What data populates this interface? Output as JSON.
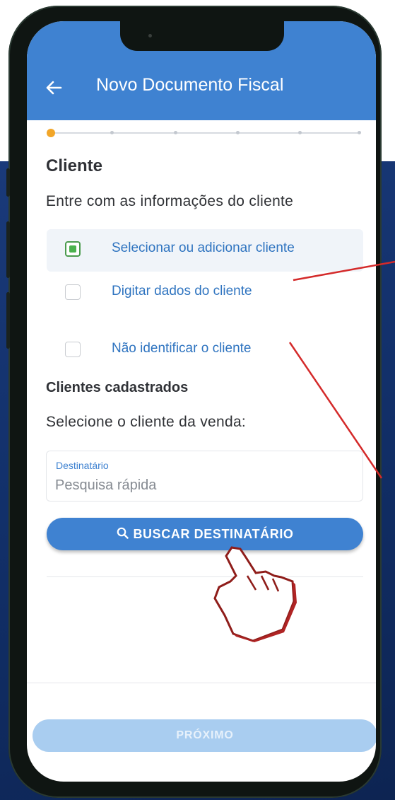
{
  "colors": {
    "appbar": "#3f82d1",
    "link": "#2f74c0",
    "check": "#4bb24e",
    "stepper_active": "#f2a629",
    "annotation": "#d42a2a",
    "next_disabled": "#a9cdf0"
  },
  "appbar": {
    "back_icon": "arrow-left-icon",
    "title": "Novo Documento Fiscal"
  },
  "stepper": {
    "total_steps": 6,
    "current_step": 1
  },
  "section": {
    "title": "Cliente",
    "subtitle": "Entre com as informações do cliente"
  },
  "options": [
    {
      "label": "Selecionar ou adicionar cliente",
      "checked": true
    },
    {
      "label": "Digitar dados do cliente",
      "checked": false
    },
    {
      "label": "Não identificar o cliente",
      "checked": false
    }
  ],
  "registered": {
    "title": "Clientes cadastrados",
    "prompt": "Selecione o cliente da venda:",
    "field_label": "Destinatário",
    "field_placeholder": "Pesquisa rápida",
    "search_icon": "search-icon",
    "search_button": "BUSCAR DESTINATÁRIO"
  },
  "footer": {
    "next_button": "PRÓXIMO"
  },
  "decorations": {
    "pointer_icon": "hand-pointer-icon"
  }
}
